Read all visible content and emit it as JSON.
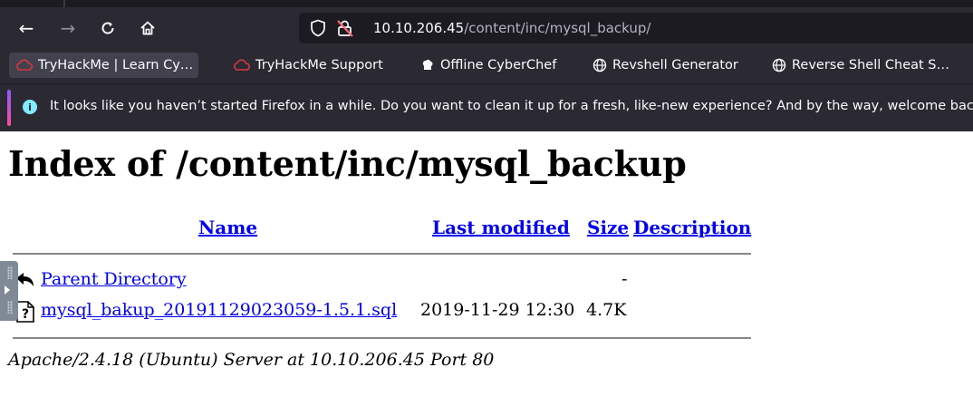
{
  "browser": {
    "url_host": "10.10.206.45",
    "url_path": "/content/inc/mysql_backup/",
    "bookmarks": [
      {
        "label": "TryHackMe | Learn Cy…",
        "icon": "tryhackme-icon"
      },
      {
        "label": "TryHackMe Support",
        "icon": "tryhackme-icon"
      },
      {
        "label": "Offline CyberChef",
        "icon": "cyberchef-icon"
      },
      {
        "label": "Revshell Generator",
        "icon": "globe-icon"
      },
      {
        "label": "Reverse Shell Cheat S…",
        "icon": "globe-icon"
      }
    ],
    "notification": "It looks like you haven’t started Firefox in a while. Do you want to clean it up for a fresh, like-new experience? And by the way, welcome back!"
  },
  "page": {
    "title": "Index of /content/inc/mysql_backup",
    "columns": {
      "name": "Name",
      "modified": "Last modified",
      "size": "Size",
      "description": "Description"
    },
    "rows": [
      {
        "name": "Parent Directory",
        "modified": "",
        "size": "-",
        "icon": "back-icon"
      },
      {
        "name": "mysql_bakup_20191129023059-1.5.1.sql",
        "modified": "2019-11-29 12:30",
        "size": "4.7K",
        "icon": "unknown-file-icon"
      }
    ],
    "address": "Apache/2.4.18 (Ubuntu) Server at 10.10.206.45 Port 80"
  },
  "colors": {
    "chrome": "#2b2a33",
    "link": "#0000ee",
    "accent_purple": "#9059ff",
    "accent_pink": "#ff4aa2",
    "info": "#80ebff",
    "tryhackme_red": "#d9363e"
  }
}
